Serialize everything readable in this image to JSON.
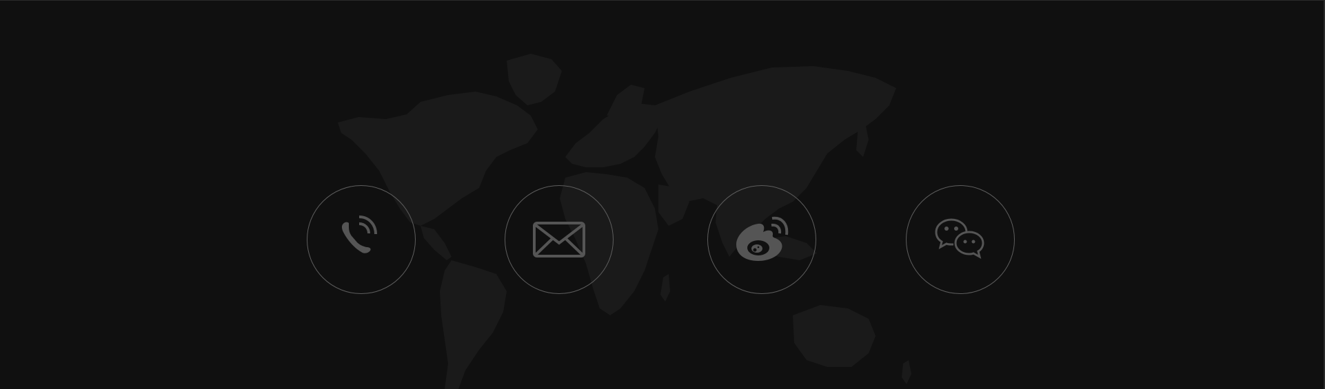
{
  "colors": {
    "background": "#101010",
    "map_land": "#1a1a1a",
    "circle_border": "#5e5e5e",
    "icon": "#555555"
  },
  "contacts": [
    {
      "icon": "phone-icon"
    },
    {
      "icon": "mail-icon"
    },
    {
      "icon": "weibo-icon"
    },
    {
      "icon": "wechat-icon"
    }
  ]
}
